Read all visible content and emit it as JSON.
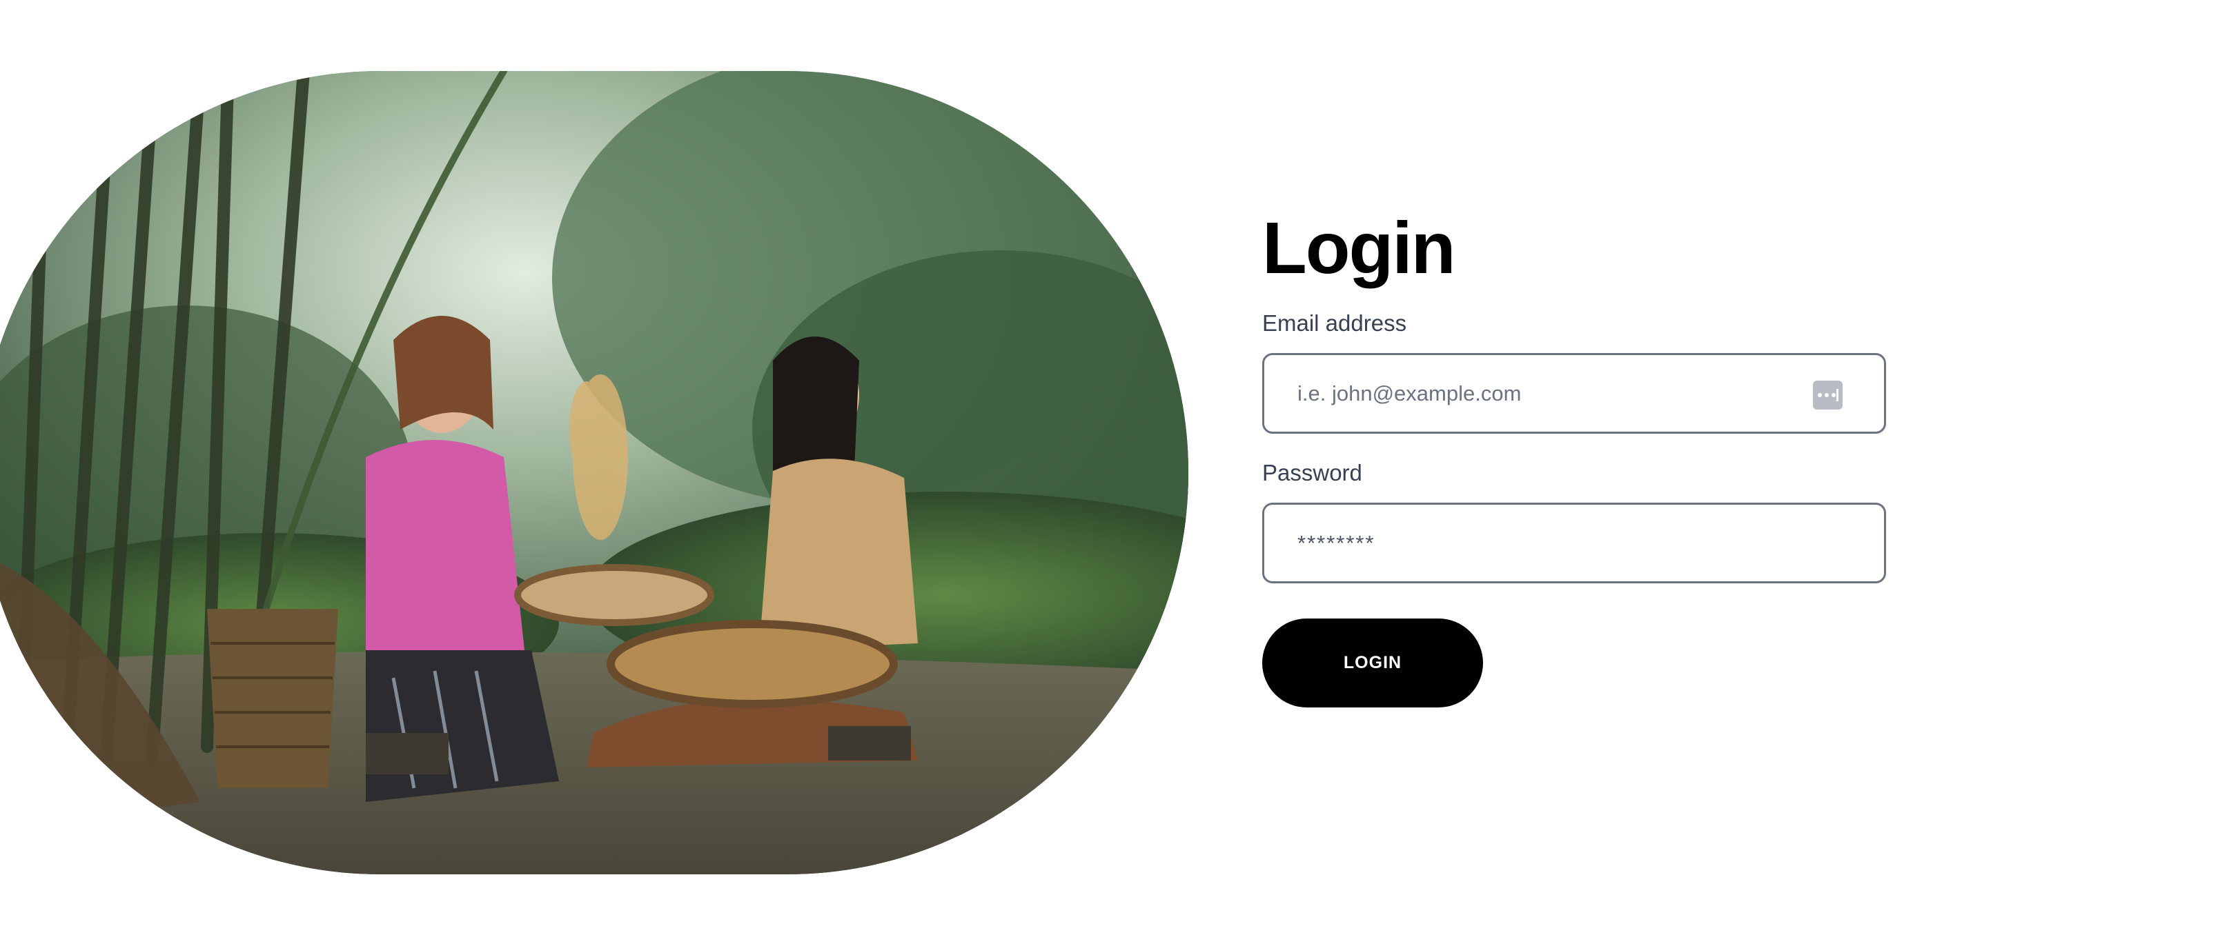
{
  "hero": {
    "image_icon": "photo-two-women-winnowing-rice-in-bamboo-forest"
  },
  "login": {
    "title": "Login",
    "email_label": "Email address",
    "email_placeholder": "i.e. john@example.com",
    "email_value": "",
    "password_label": "Password",
    "password_value": "********",
    "submit_label": "LOGIN"
  },
  "icons": {
    "autofill": "password-manager-autofill-icon"
  },
  "colors": {
    "button_bg": "#000000",
    "button_text": "#ffffff",
    "input_border": "#6b7280",
    "label_text": "#374151",
    "page_bg": "#ffffff"
  }
}
